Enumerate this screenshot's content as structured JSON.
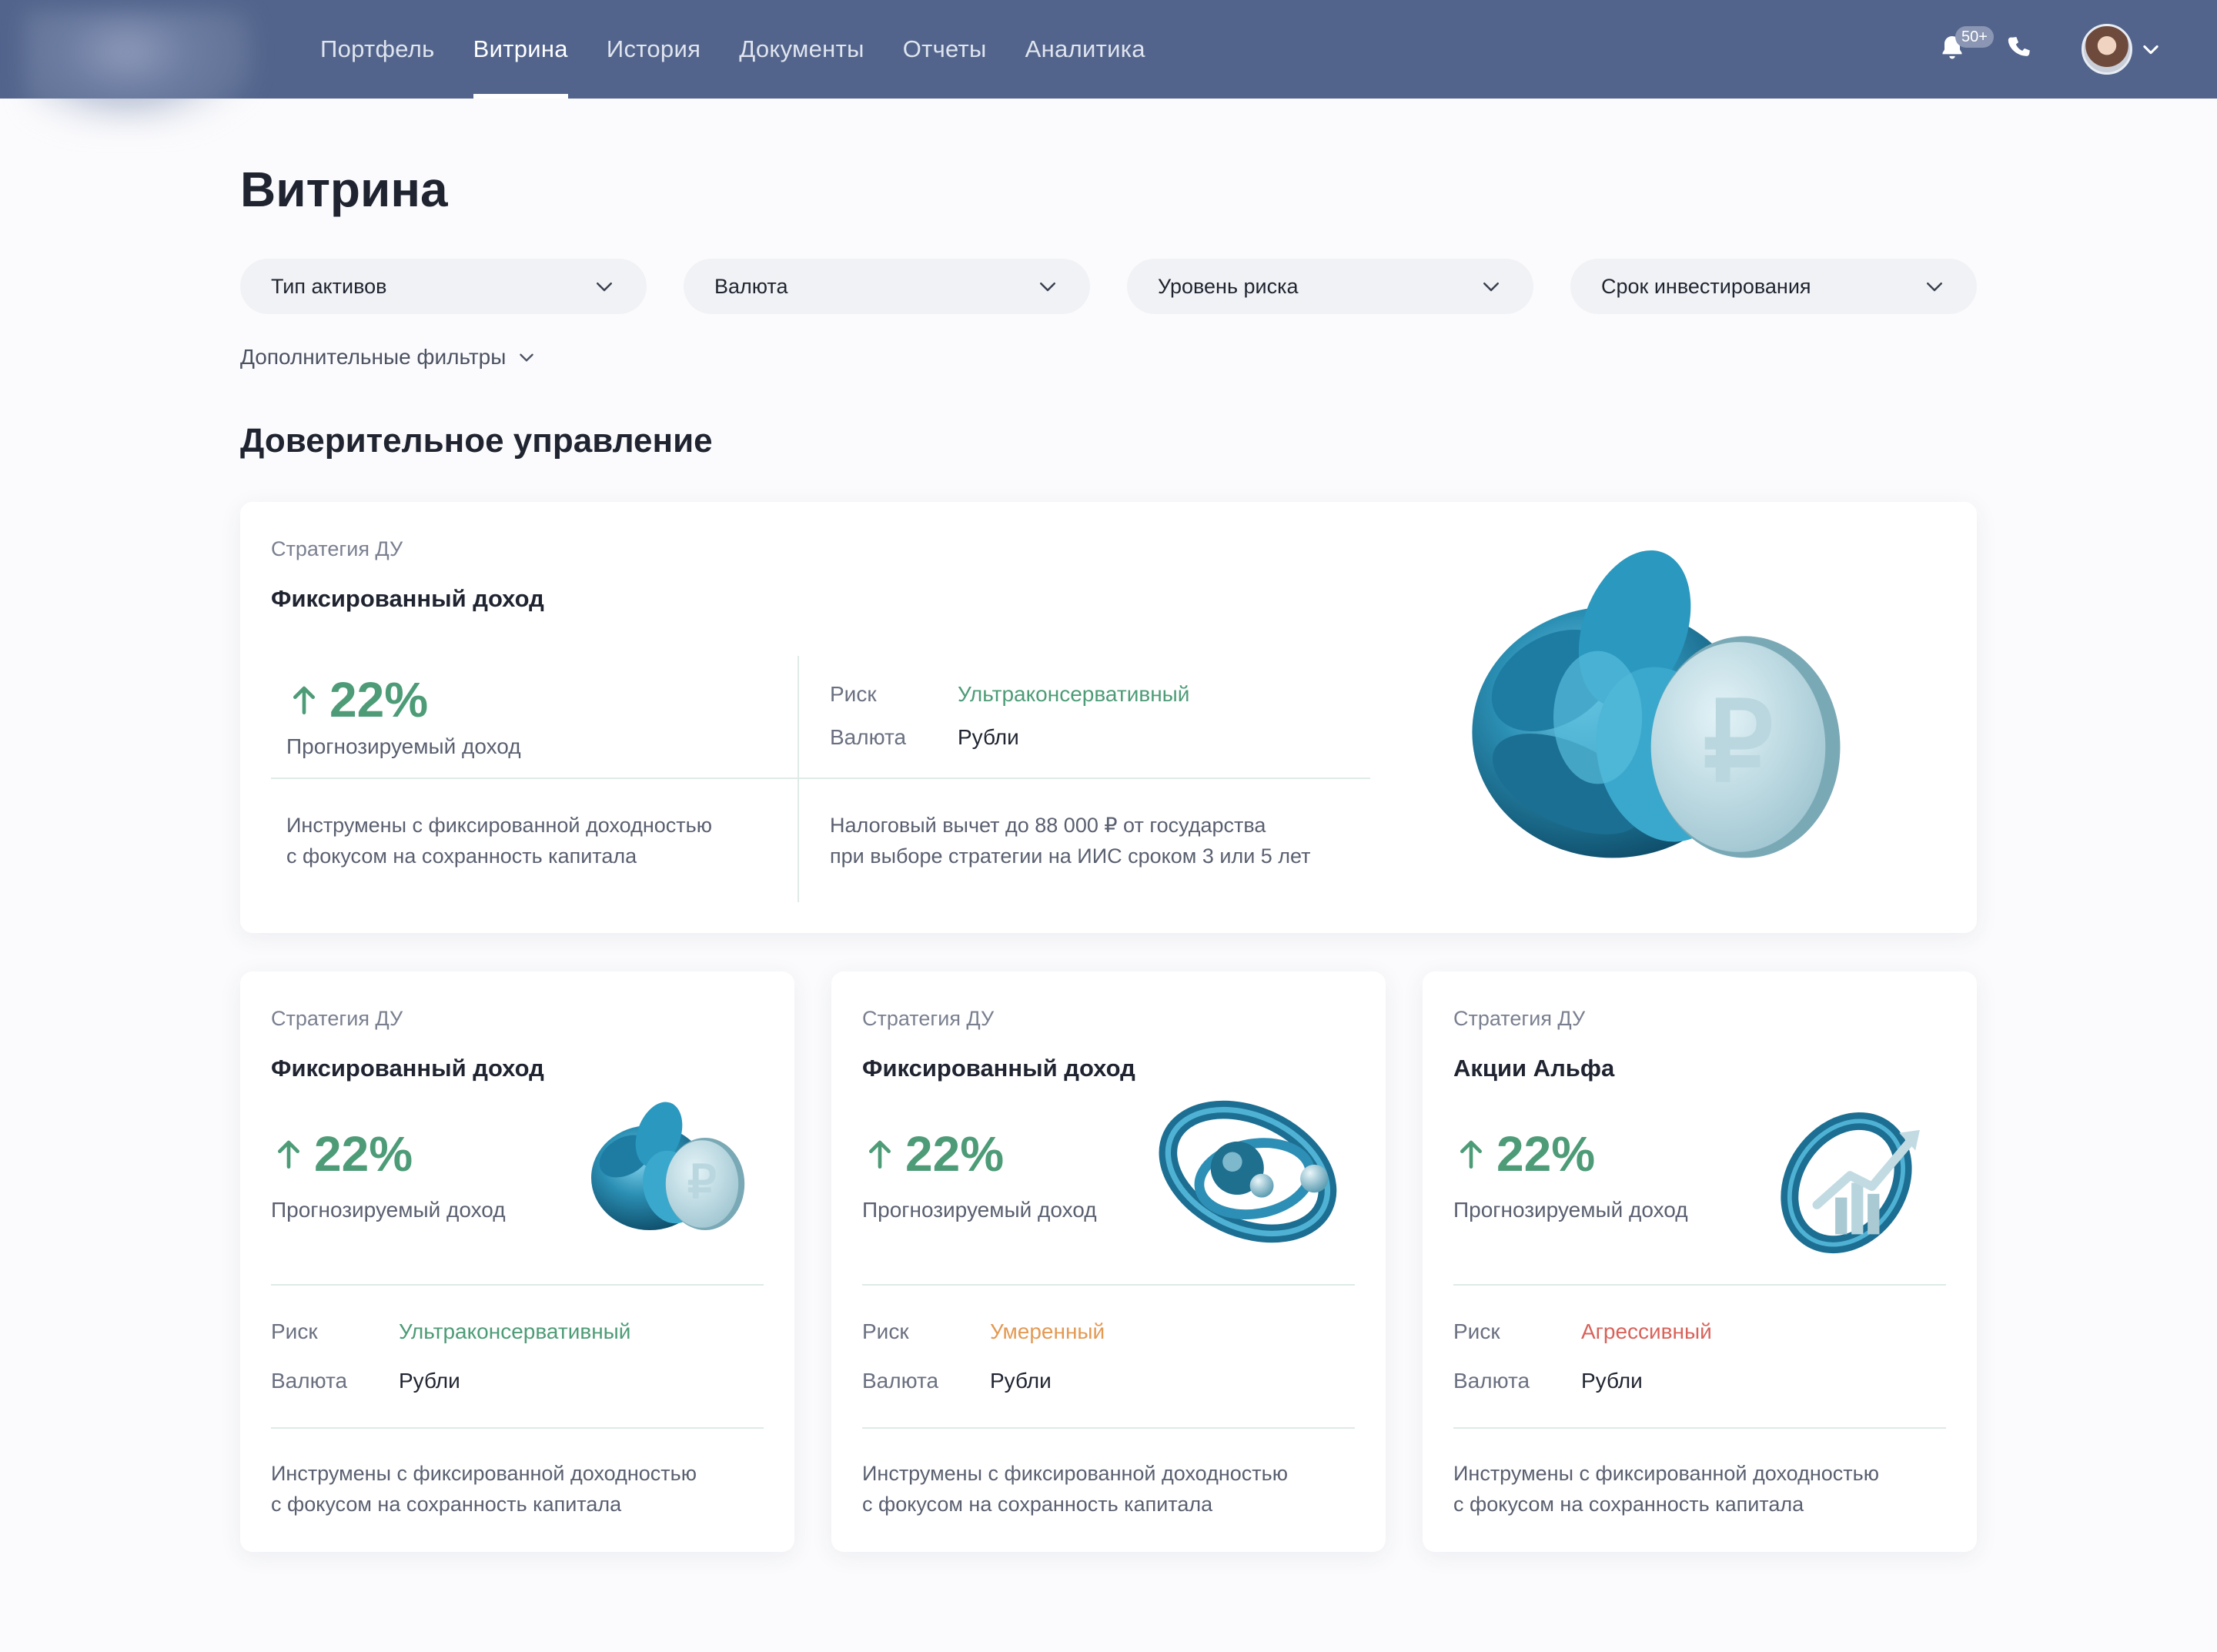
{
  "nav": {
    "items": [
      "Портфель",
      "Витрина",
      "История",
      "Документы",
      "Отчеты",
      "Аналитика"
    ],
    "active": "Витрина",
    "notifications_badge": "50+"
  },
  "page": {
    "title": "Витрина",
    "filters": [
      "Тип активов",
      "Валюта",
      "Уровень риска",
      "Срок инвестирования"
    ],
    "more_filters": "Дополнительные фильтры",
    "section_title": "Доверительное управление"
  },
  "featured": {
    "kicker": "Стратегия ДУ",
    "name": "Фиксированный доход",
    "percent": "22%",
    "percent_label": "Прогнозируемый доход",
    "risk_label": "Риск",
    "risk_value": "Ультраконсервативный",
    "currency_label": "Валюта",
    "currency_value": "Рубли",
    "desc_left_1": "Инструмены с фиксированной доходностью",
    "desc_left_2": "с фокусом на сохранность капитала",
    "desc_right_1": "Налоговый вычет до 88 000 ₽ от государства",
    "desc_right_2": "при выборе стратегии на ИИС сроком 3 или 5 лет",
    "image_icon": "ruble-coin-knot-icon"
  },
  "cards": [
    {
      "kicker": "Стратегия ДУ",
      "name": "Фиксированный доход",
      "percent": "22%",
      "percent_label": "Прогнозируемый доход",
      "risk_label": "Риск",
      "risk_value": "Ультраконсервативный",
      "risk_color": "#4d9c77",
      "currency_label": "Валюта",
      "currency_value": "Рубли",
      "desc_1": "Инструмены с фиксированной доходностью",
      "desc_2": "с фокусом на сохранность капитала",
      "image_icon": "ruble-coin-knot-icon"
    },
    {
      "kicker": "Стратегия ДУ",
      "name": "Фиксированный доход",
      "percent": "22%",
      "percent_label": "Прогнозируемый доход",
      "risk_label": "Риск",
      "risk_value": "Умеренный",
      "risk_color": "#e39a54",
      "currency_label": "Валюта",
      "currency_value": "Рубли",
      "desc_1": "Инструмены с фиксированной доходностью",
      "desc_2": "с фокусом на сохранность капитала",
      "image_icon": "orbit-spheres-icon"
    },
    {
      "kicker": "Стратегия ДУ",
      "name": "Акции Альфа",
      "percent": "22%",
      "percent_label": "Прогнозируемый доход",
      "risk_label": "Риск",
      "risk_value": "Агрессивный",
      "risk_color": "#d9625a",
      "currency_label": "Валюта",
      "currency_value": "Рубли",
      "desc_1": "Инструмены с фиксированной доходностью",
      "desc_2": "с фокусом на сохранность капитала",
      "image_icon": "growth-chart-ring-icon"
    }
  ],
  "colors": {
    "nav_bg": "#52648c",
    "accent_green": "#4d9c77",
    "risk_orange": "#e39a54",
    "risk_red": "#d9625a"
  }
}
